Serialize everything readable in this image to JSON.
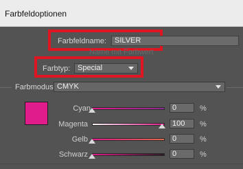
{
  "dialog": {
    "title": "Farbfeldoptionen"
  },
  "swatch_name": {
    "label": "Farbfeldname:",
    "value": "SILVER"
  },
  "ghost_text": "Name mit Farbwert",
  "color_type": {
    "label": "Farbtyp:",
    "value": "Special"
  },
  "color_mode": {
    "label": "Farbmodus:",
    "value": "CMYK"
  },
  "sliders": [
    {
      "name": "Cyan",
      "value": "0",
      "unit": "%"
    },
    {
      "name": "Magenta",
      "value": "100",
      "unit": "%"
    },
    {
      "name": "Gelb",
      "value": "0",
      "unit": "%"
    },
    {
      "name": "Schwarz",
      "value": "0",
      "unit": "%"
    }
  ],
  "colors": {
    "swatch": "#e01b8a",
    "highlight": "#e01522",
    "panel": "#535353"
  }
}
